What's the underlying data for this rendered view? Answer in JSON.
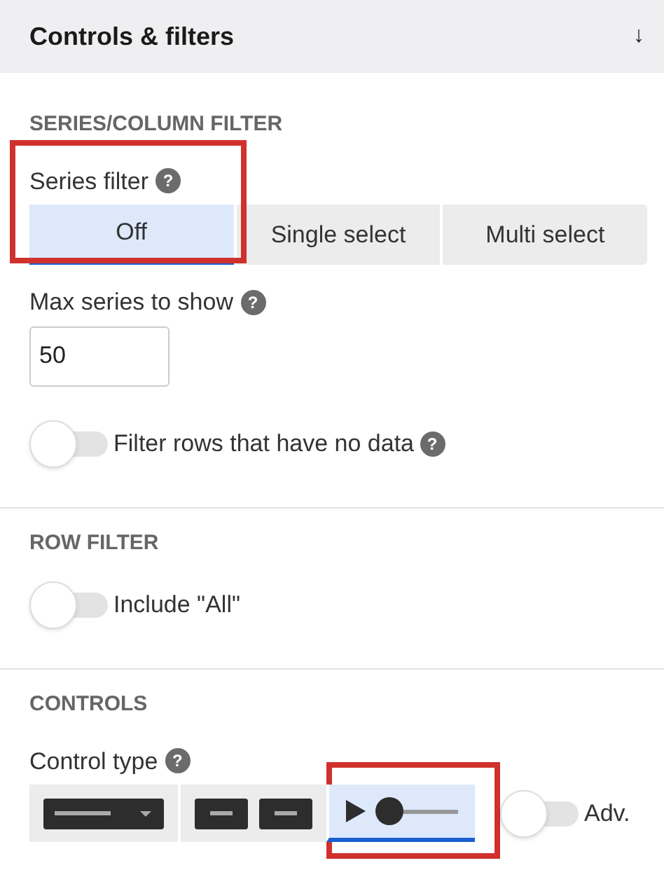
{
  "panel": {
    "title": "Controls & filters",
    "toggle_glyph": "↓"
  },
  "sections": [
    {
      "heading": "SERIES/COLUMN FILTER",
      "items": [
        {
          "kind": "segmented",
          "label": "Series filter",
          "help": "?",
          "highlighted": true,
          "options": [
            {
              "label": "Off",
              "selected": true
            },
            {
              "label": "Single select",
              "selected": false
            },
            {
              "label": "Multi select",
              "selected": false
            }
          ]
        },
        {
          "kind": "number",
          "label": "Max series to show",
          "help": "?",
          "value": "50"
        },
        {
          "kind": "switch",
          "label": "Filter rows that have no data",
          "help": "?",
          "on": false
        }
      ]
    },
    {
      "heading": "ROW FILTER",
      "items": [
        {
          "kind": "switch",
          "label": "Include \"All\"",
          "on": false
        }
      ]
    },
    {
      "heading": "CONTROLS",
      "items": [
        {
          "kind": "control_type",
          "label": "Control type",
          "help": "?",
          "options": [
            {
              "kind": "dropdown",
              "selected": false
            },
            {
              "kind": "buttons",
              "selected": false
            },
            {
              "kind": "slider",
              "selected": true,
              "highlighted": true
            }
          ],
          "switch": {
            "label": "Adv.",
            "on": false
          }
        }
      ]
    }
  ]
}
